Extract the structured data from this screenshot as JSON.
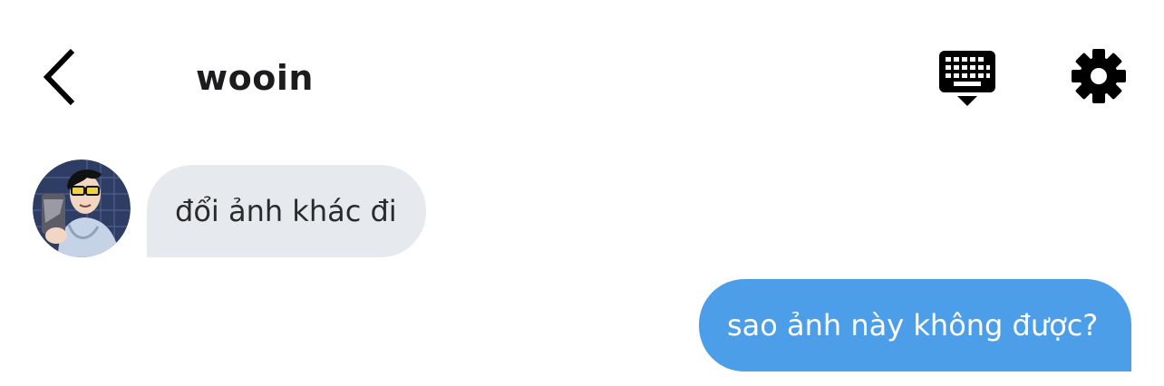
{
  "header": {
    "back_icon": "chevron-left-icon",
    "title": "wooin",
    "keyboard_icon": "keyboard-hide-icon",
    "settings_icon": "gear-icon"
  },
  "messages": [
    {
      "direction": "incoming",
      "sender": "wooin",
      "text": "đổi ảnh khác đi",
      "bubble_color": "#e6eaef",
      "text_color": "#2b2b2b"
    },
    {
      "direction": "outgoing",
      "text": "sao ảnh này không được?",
      "bubble_color": "#4d9ee8",
      "text_color": "#ffffff"
    }
  ],
  "theme": {
    "background": "#ffffff",
    "icon_color": "#000000"
  }
}
